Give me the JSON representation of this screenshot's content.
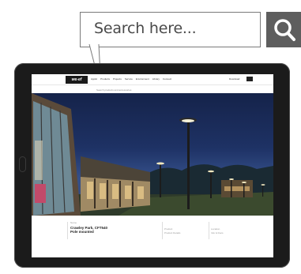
{
  "search": {
    "placeholder": "Search here...",
    "icon": "search-icon",
    "button_color": "#5e5e5e"
  },
  "site": {
    "logo": "we-ef",
    "nav": [
      "Applic",
      "Products",
      "Projects",
      "Service",
      "Environment",
      "Library",
      "Connect"
    ],
    "download": "Download",
    "search_line": "Search products and accessories"
  },
  "project": {
    "label": "Name",
    "title_line1": "Crawley Park, CFT540",
    "title_line2": "Pole mounted",
    "col2_label": "Product",
    "col2_value": "Product Details",
    "col3_label": "Location",
    "col3_value": "Info & Docs"
  }
}
